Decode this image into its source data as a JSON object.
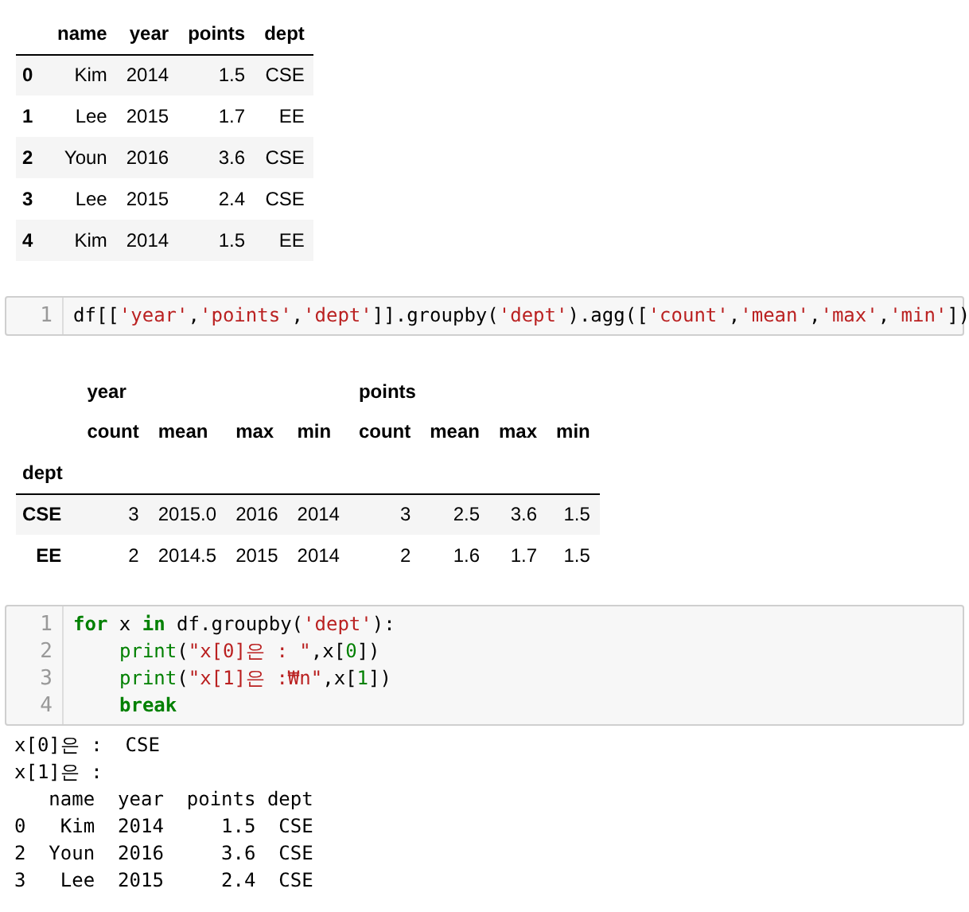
{
  "table1": {
    "columns": [
      "name",
      "year",
      "points",
      "dept"
    ],
    "rows": [
      {
        "index": "0",
        "cells": [
          "Kim",
          "2014",
          "1.5",
          "CSE"
        ]
      },
      {
        "index": "1",
        "cells": [
          "Lee",
          "2015",
          "1.7",
          "EE"
        ]
      },
      {
        "index": "2",
        "cells": [
          "Youn",
          "2016",
          "3.6",
          "CSE"
        ]
      },
      {
        "index": "3",
        "cells": [
          "Lee",
          "2015",
          "2.4",
          "CSE"
        ]
      },
      {
        "index": "4",
        "cells": [
          "Kim",
          "2014",
          "1.5",
          "EE"
        ]
      }
    ]
  },
  "cell1": {
    "lines": [
      {
        "number": "1",
        "tokens": [
          {
            "kind": "plain",
            "text": "df[["
          },
          {
            "kind": "string",
            "text": "'year'"
          },
          {
            "kind": "plain",
            "text": ","
          },
          {
            "kind": "string",
            "text": "'points'"
          },
          {
            "kind": "plain",
            "text": ","
          },
          {
            "kind": "string",
            "text": "'dept'"
          },
          {
            "kind": "plain",
            "text": "]].groupby("
          },
          {
            "kind": "string",
            "text": "'dept'"
          },
          {
            "kind": "plain",
            "text": ").agg(["
          },
          {
            "kind": "string",
            "text": "'count'"
          },
          {
            "kind": "plain",
            "text": ","
          },
          {
            "kind": "string",
            "text": "'mean'"
          },
          {
            "kind": "plain",
            "text": ","
          },
          {
            "kind": "string",
            "text": "'max'"
          },
          {
            "kind": "plain",
            "text": ","
          },
          {
            "kind": "string",
            "text": "'min'"
          },
          {
            "kind": "plain",
            "text": "])"
          }
        ]
      }
    ]
  },
  "table2": {
    "groups": [
      {
        "label": "year"
      },
      {
        "label": "points"
      }
    ],
    "columns": [
      "count",
      "mean",
      "max",
      "min",
      "count",
      "mean",
      "max",
      "min"
    ],
    "index_name": "dept",
    "rows": [
      {
        "index": "CSE",
        "cells": [
          "3",
          "2015.0",
          "2016",
          "2014",
          "3",
          "2.5",
          "3.6",
          "1.5"
        ]
      },
      {
        "index": "EE",
        "cells": [
          "2",
          "2014.5",
          "2015",
          "2014",
          "2",
          "1.6",
          "1.7",
          "1.5"
        ]
      }
    ]
  },
  "cell2": {
    "lines": [
      {
        "number": "1",
        "tokens": [
          {
            "kind": "keyword",
            "text": "for"
          },
          {
            "kind": "plain",
            "text": " x "
          },
          {
            "kind": "keyword",
            "text": "in"
          },
          {
            "kind": "plain",
            "text": " df.groupby("
          },
          {
            "kind": "string",
            "text": "'dept'"
          },
          {
            "kind": "plain",
            "text": "):"
          }
        ]
      },
      {
        "number": "2",
        "indented": true,
        "tokens": [
          {
            "kind": "builtin",
            "text": "print"
          },
          {
            "kind": "plain",
            "text": "("
          },
          {
            "kind": "string",
            "text": "\"x[0]은 : \""
          },
          {
            "kind": "plain",
            "text": ",x["
          },
          {
            "kind": "number",
            "text": "0"
          },
          {
            "kind": "plain",
            "text": "])"
          }
        ]
      },
      {
        "number": "3",
        "indented": true,
        "tokens": [
          {
            "kind": "builtin",
            "text": "print"
          },
          {
            "kind": "plain",
            "text": "("
          },
          {
            "kind": "string",
            "text": "\"x[1]은 :₩n\""
          },
          {
            "kind": "plain",
            "text": ",x["
          },
          {
            "kind": "number",
            "text": "1"
          },
          {
            "kind": "plain",
            "text": "])"
          }
        ]
      },
      {
        "number": "4",
        "indented": true,
        "tokens": [
          {
            "kind": "keyword",
            "text": "break"
          }
        ]
      }
    ]
  },
  "output": {
    "lines": [
      "x[0]은 :  CSE",
      "x[1]은 :",
      "   name  year  points dept",
      "0   Kim  2014     1.5  CSE",
      "2  Youn  2016     3.6  CSE",
      "3   Lee  2015     2.4  CSE"
    ]
  }
}
